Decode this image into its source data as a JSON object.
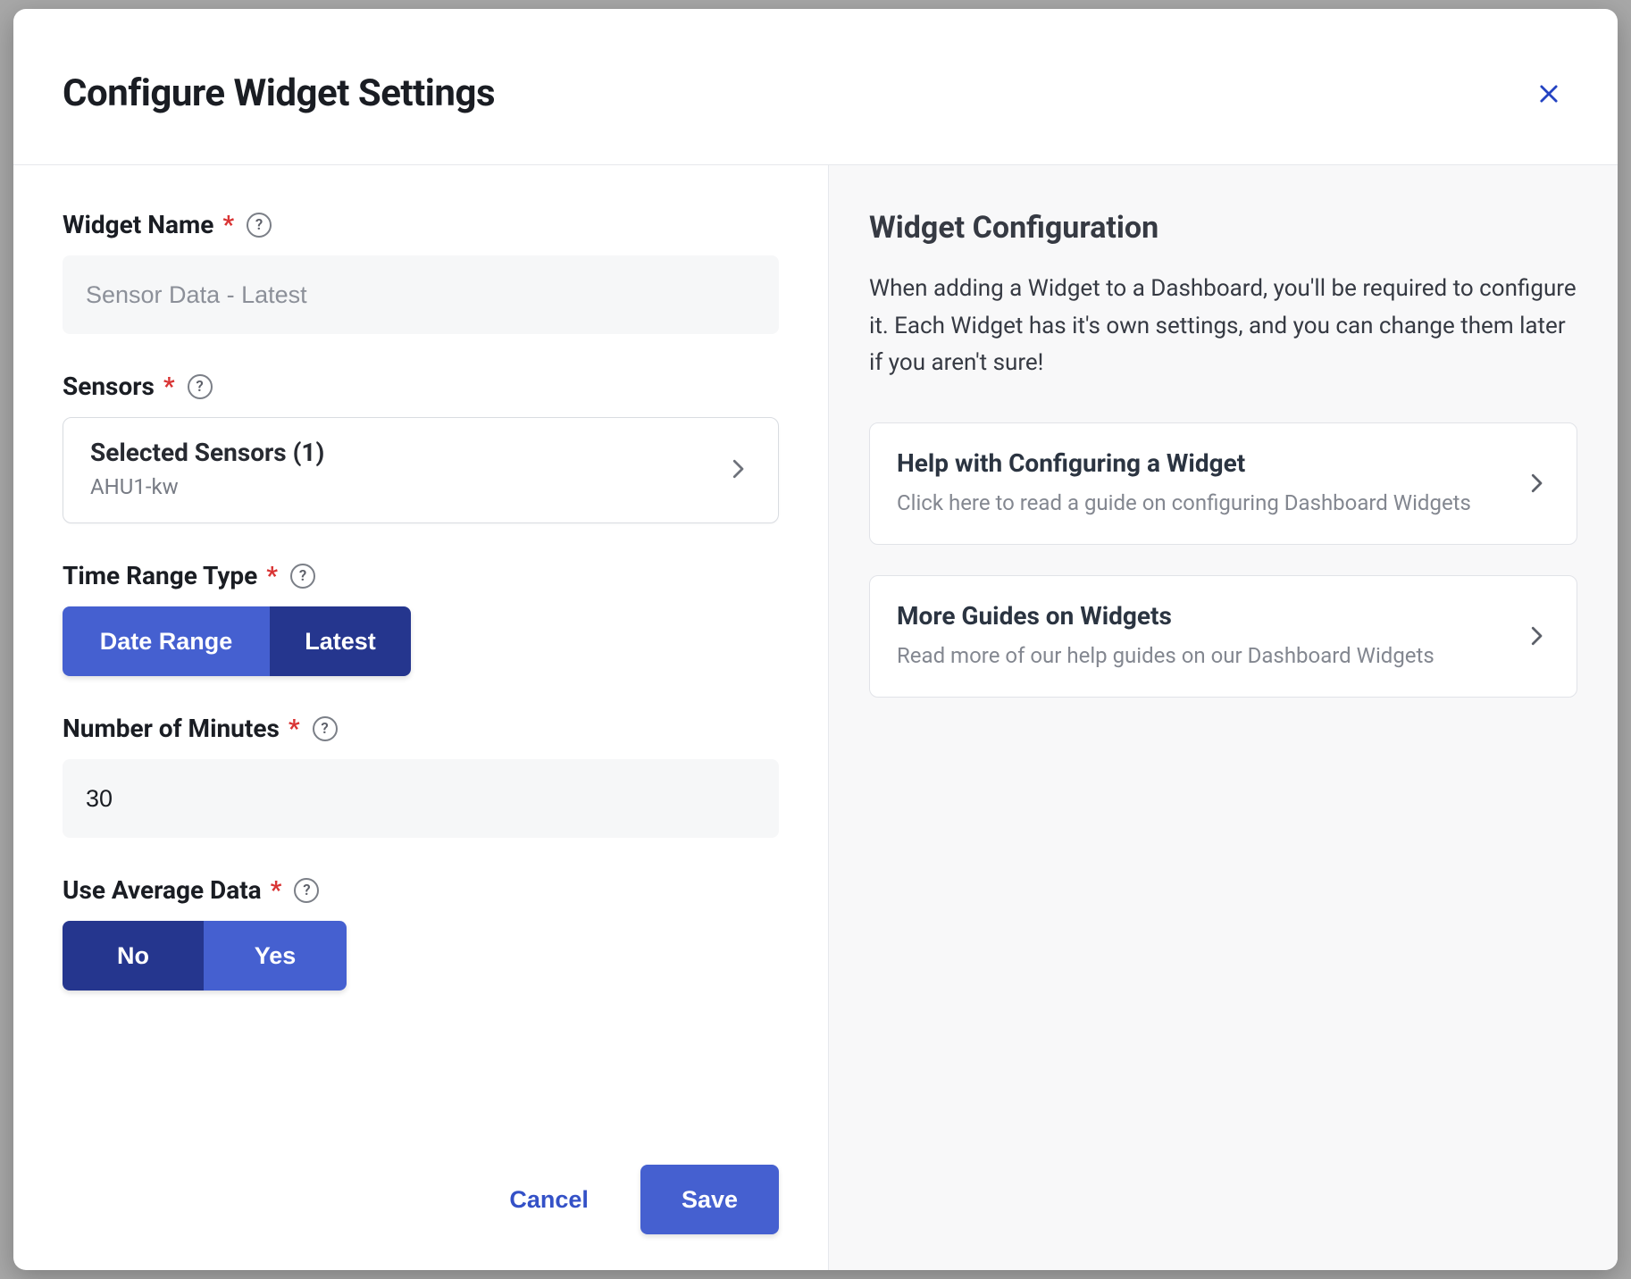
{
  "header": {
    "title": "Configure Widget Settings"
  },
  "form": {
    "widgetName": {
      "label": "Widget Name",
      "placeholder": "Sensor Data - Latest",
      "value": ""
    },
    "sensors": {
      "label": "Sensors",
      "selectedTitle": "Selected Sensors (1)",
      "selectedList": "AHU1-kw"
    },
    "timeRange": {
      "label": "Time Range Type",
      "options": {
        "dateRange": "Date Range",
        "latest": "Latest"
      },
      "selected": "latest"
    },
    "minutes": {
      "label": "Number of Minutes",
      "value": "30"
    },
    "useAverage": {
      "label": "Use Average Data",
      "options": {
        "no": "No",
        "yes": "Yes"
      },
      "selected": "no"
    }
  },
  "actions": {
    "cancel": "Cancel",
    "save": "Save"
  },
  "sidebar": {
    "title": "Widget Configuration",
    "description": "When adding a Widget to a Dashboard, you'll be required to configure it. Each Widget has it's own settings, and you can change them later if you aren't sure!",
    "guides": [
      {
        "title": "Help with Configuring a Widget",
        "subtitle": "Click here to read a guide on configuring Dashboard Widgets"
      },
      {
        "title": "More Guides on Widgets",
        "subtitle": "Read more of our help guides on our Dashboard Widgets"
      }
    ]
  }
}
